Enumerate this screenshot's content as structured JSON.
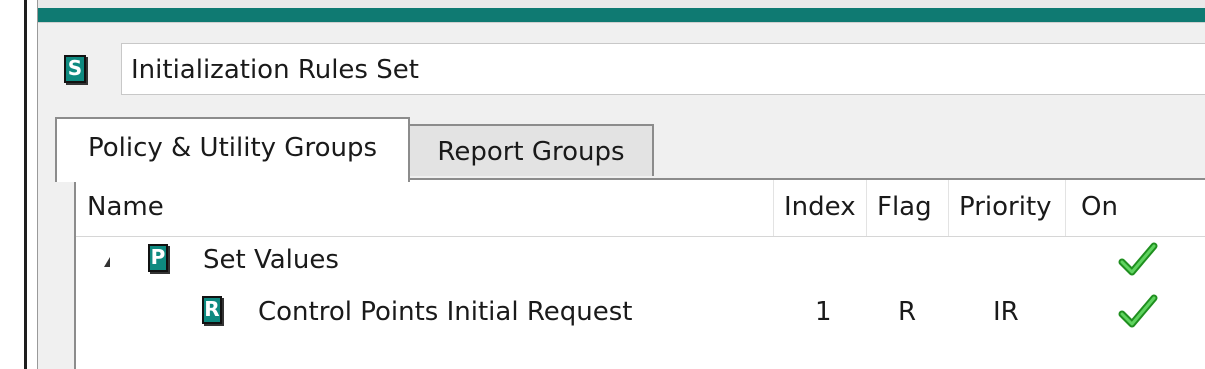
{
  "rule_set": {
    "icon_letter": "S",
    "name": "Initialization Rules Set"
  },
  "tabs": [
    {
      "label": "Policy & Utility Groups",
      "active": true
    },
    {
      "label": "Report Groups",
      "active": false
    }
  ],
  "grid": {
    "columns": [
      "Name",
      "Index",
      "Flag",
      "Priority",
      "On"
    ],
    "rows": [
      {
        "icon_letter": "P",
        "name": "Set Values",
        "index": "",
        "flag": "",
        "priority": "",
        "on": true,
        "expanded": true
      },
      {
        "icon_letter": "R",
        "name": "Control Points Initial Request",
        "index": "1",
        "flag": "R",
        "priority": "IR",
        "on": true
      }
    ]
  },
  "colors": {
    "accent": "#0f7a72",
    "icon_fill": "#0e8a80",
    "check": "#2db52d"
  }
}
